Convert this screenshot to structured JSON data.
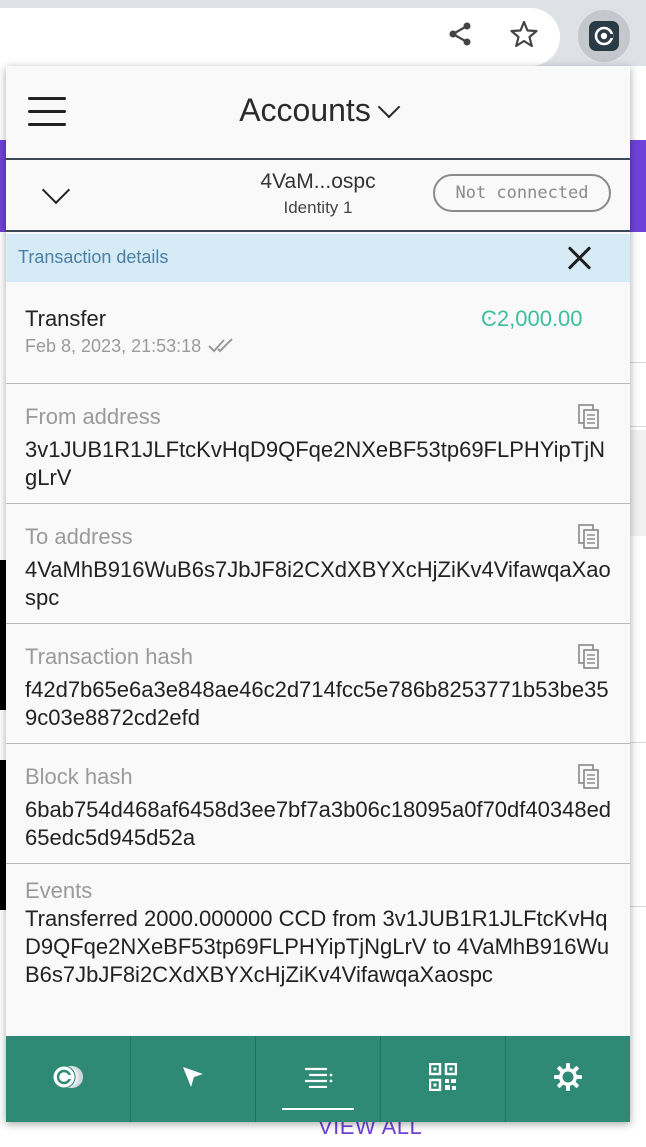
{
  "browser": {
    "share_icon": "share-icon",
    "bookmark_icon": "star-icon",
    "extension_icon": "concordium-extension-icon"
  },
  "background_page": {
    "view_all": "VIEW ALL"
  },
  "header": {
    "menu_icon": "hamburger-icon",
    "title": "Accounts"
  },
  "account": {
    "short_address": "4VaM...ospc",
    "identity": "Identity 1",
    "connection_status": "Not connected"
  },
  "details": {
    "title": "Transaction details",
    "type": "Transfer",
    "amount": "Ͼ2,000.00",
    "date": "Feb 8, 2023, 21:53:18",
    "status_icon": "finalized-double-check-icon",
    "fields": [
      {
        "label": "From address",
        "value": "3v1JUB1R1JLFtcKvHqD9QFqe2NXeBF53tp69FLPHYipTjNgLrV"
      },
      {
        "label": "To address",
        "value": "4VaMhB916WuB6s7JbJF8i2CXdXBYXcHjZiKv4VifawqaXaospc"
      },
      {
        "label": "Transaction hash",
        "value": "f42d7b65e6a3e848ae46c2d714fcc5e786b8253771b53be359c03e8872cd2efd"
      },
      {
        "label": "Block hash",
        "value": "6bab754d468af6458d3ee7bf7a3b06c18095a0f70df40348ed65edc5d945d52a"
      }
    ],
    "events_label": "Events",
    "events_value": "Transferred 2000.000000 CCD from 3v1JUB1R1JLFtcKvHqD9QFqe2NXeBF53tp69FLPHYipTjNgLrV to 4VaMhB916WuB6s7JbJF8i2CXdXBYXcHjZiKv4VifawqaXaospc"
  },
  "nav": [
    {
      "icon": "accounts-coin-icon"
    },
    {
      "icon": "send-cursor-icon"
    },
    {
      "icon": "transaction-list-icon",
      "active": true
    },
    {
      "icon": "qr-code-icon"
    },
    {
      "icon": "settings-gear-icon"
    }
  ],
  "colors": {
    "nav_bg": "#2f8a75",
    "amount": "#3cbf9d",
    "details_head_bg": "#d6ebf6",
    "accent_purple": "#6f42d9"
  }
}
